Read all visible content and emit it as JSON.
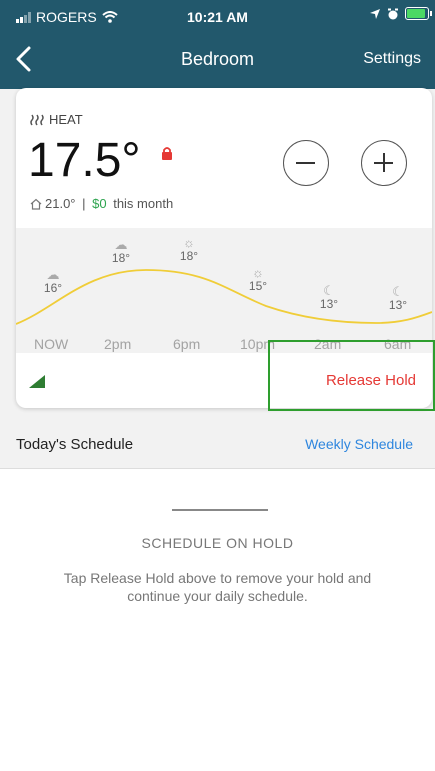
{
  "status_bar": {
    "carrier": "ROGERS",
    "time": "10:21 AM",
    "icons": [
      "signal-bars-icon",
      "wifi-icon",
      "location-arrow-icon",
      "alarm-icon",
      "battery-icon"
    ]
  },
  "nav": {
    "back_icon": "chevron-left-icon",
    "title": "Bedroom",
    "settings_label": "Settings"
  },
  "thermostat": {
    "mode_icon": "heat-waves-icon",
    "mode": "HEAT",
    "setpoint": "17.5°",
    "lock_icon": "lock-icon",
    "minus_icon": "minus-icon",
    "plus_icon": "plus-icon",
    "indoor_icon": "home-icon",
    "indoor_temp": "21.0°",
    "separator": " | ",
    "cost": "$0",
    "cost_suffix": " this month",
    "release_hold_label": "Release Hold",
    "signal_icon": "signal-strength-icon"
  },
  "forecast": {
    "times": [
      "NOW",
      "2pm",
      "6pm",
      "10pm",
      "2am",
      "6am"
    ],
    "entries": [
      {
        "temp": "16°",
        "icon": "partly-cloudy-icon"
      },
      {
        "temp": "18°",
        "icon": "partly-cloudy-icon"
      },
      {
        "temp": "18°",
        "icon": "sun-icon"
      },
      {
        "temp": "15°",
        "icon": "sun-icon"
      },
      {
        "temp": "13°",
        "icon": "moon-icon"
      },
      {
        "temp": "13°",
        "icon": "moon-icon"
      }
    ]
  },
  "schedule": {
    "title": "Today's Schedule",
    "weekly_link": "Weekly Schedule",
    "hold_title": "SCHEDULE ON HOLD",
    "hold_message": "Tap Release Hold above to remove your hold and continue your daily schedule."
  },
  "colors": {
    "header_bg": "#22586c",
    "accent_blue": "#2e86de",
    "hold_red": "#e53935",
    "cost_green": "#2ea44f",
    "highlight_green": "#2e9e2e"
  }
}
